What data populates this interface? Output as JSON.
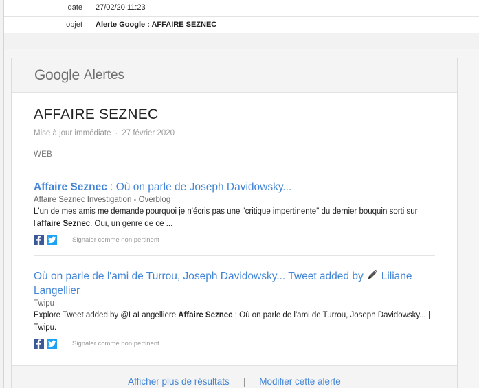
{
  "meta": {
    "rows": [
      {
        "label": "date",
        "value": "27/02/20 11:23"
      },
      {
        "label": "objet",
        "value": "Alerte Google : AFFAIRE SEZNEC"
      }
    ]
  },
  "header": {
    "logo": "Google",
    "logo_sub": "Alertes"
  },
  "alert": {
    "title": "AFFAIRE SEZNEC",
    "frequency": "Mise à jour immédiate",
    "separator": "·",
    "date": "27 février 2020",
    "section": "WEB"
  },
  "results": [
    {
      "title_bold": "Affaire Seznec",
      "title_rest": " : Où on parle de Joseph Davidowsky...",
      "source": "Affaire Seznec Investigation - Overblog",
      "snippet_pre": "L'un de mes amis me demande pourquoi je n'écris pas une \"critique impertinente\" du dernier bouquin sorti sur l'",
      "snippet_bold": "affaire Seznec",
      "snippet_post": ". Oui, un genre de ce ...",
      "report": "Signaler comme non pertinent"
    },
    {
      "title_pre": "Où on parle de l'ami de Turrou, Joseph Davidowsky... Tweet added by",
      "title_post": "Liliane Langellier",
      "source": "Twipu",
      "snippet_pre": "Explore Tweet added by @LaLangelliere ",
      "snippet_bold": "Affaire Seznec",
      "snippet_post": " : Où on parle de l'ami de Turrou, Joseph Davidowsky... | Twipu.",
      "report": "Signaler comme non pertinent"
    }
  ],
  "footer": {
    "more": "Afficher plus de résultats",
    "sep": "|",
    "edit": "Modifier cette alerte"
  },
  "colors": {
    "link": "#4285d6",
    "facebook": "#3b5998",
    "twitter": "#1da1f2"
  }
}
